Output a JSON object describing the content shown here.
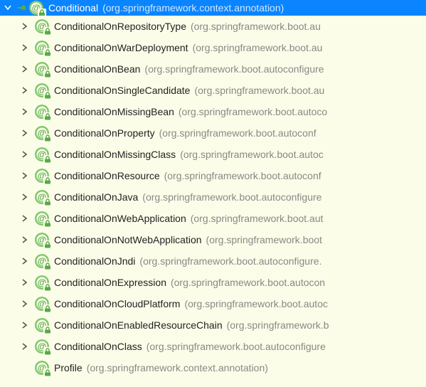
{
  "root": {
    "name": "Conditional",
    "pkg": "(org.springframework.context.annotation)"
  },
  "children": [
    {
      "name": "ConditionalOnRepositoryType",
      "pkg": "(org.springframework.boot.au",
      "expandable": true
    },
    {
      "name": "ConditionalOnWarDeployment",
      "pkg": "(org.springframework.boot.au",
      "expandable": true
    },
    {
      "name": "ConditionalOnBean",
      "pkg": "(org.springframework.boot.autoconfigure",
      "expandable": true
    },
    {
      "name": "ConditionalOnSingleCandidate",
      "pkg": "(org.springframework.boot.au",
      "expandable": true
    },
    {
      "name": "ConditionalOnMissingBean",
      "pkg": "(org.springframework.boot.autoco",
      "expandable": true
    },
    {
      "name": "ConditionalOnProperty",
      "pkg": "(org.springframework.boot.autoconf",
      "expandable": true
    },
    {
      "name": "ConditionalOnMissingClass",
      "pkg": "(org.springframework.boot.autoc",
      "expandable": true
    },
    {
      "name": "ConditionalOnResource",
      "pkg": "(org.springframework.boot.autoconf",
      "expandable": true
    },
    {
      "name": "ConditionalOnJava",
      "pkg": "(org.springframework.boot.autoconfigure",
      "expandable": true
    },
    {
      "name": "ConditionalOnWebApplication",
      "pkg": "(org.springframework.boot.aut",
      "expandable": true
    },
    {
      "name": "ConditionalOnNotWebApplication",
      "pkg": "(org.springframework.boot",
      "expandable": true
    },
    {
      "name": "ConditionalOnJndi",
      "pkg": "(org.springframework.boot.autoconfigure.",
      "expandable": true
    },
    {
      "name": "ConditionalOnExpression",
      "pkg": "(org.springframework.boot.autocon",
      "expandable": true
    },
    {
      "name": "ConditionalOnCloudPlatform",
      "pkg": "(org.springframework.boot.autoc",
      "expandable": true
    },
    {
      "name": "ConditionalOnEnabledResourceChain",
      "pkg": "(org.springframework.b",
      "expandable": true
    },
    {
      "name": "ConditionalOnClass",
      "pkg": "(org.springframework.boot.autoconfigure",
      "expandable": true
    },
    {
      "name": "Profile",
      "pkg": "(org.springframework.context.annotation)",
      "expandable": false
    }
  ]
}
